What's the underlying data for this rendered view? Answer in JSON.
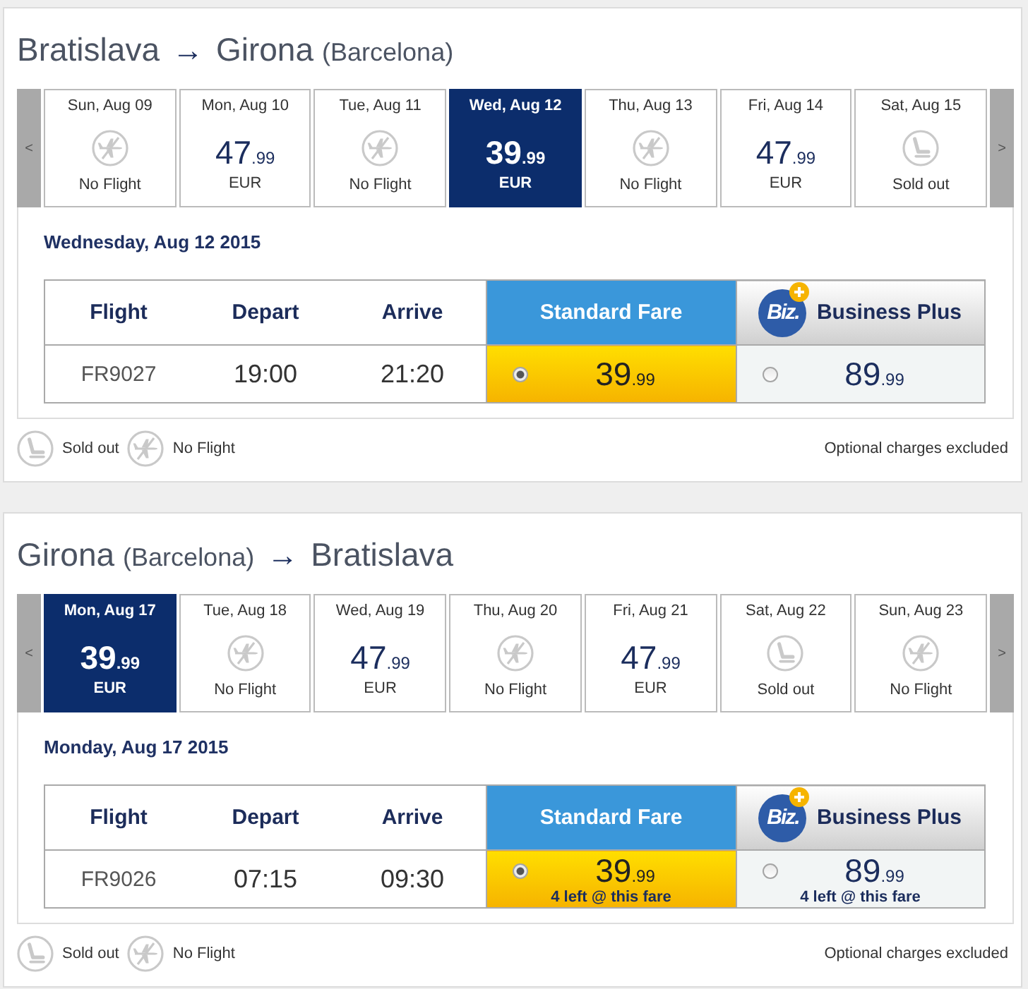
{
  "journeys": [
    {
      "origin": {
        "city": "Bratislava"
      },
      "arrow": "→",
      "destination": {
        "city": "Girona",
        "area": "(Barcelona)"
      },
      "prev_label": "<",
      "next_label": ">",
      "days": [
        {
          "date": "Sun, Aug 09",
          "kind": "no_flight",
          "label": "No Flight",
          "selected": false
        },
        {
          "date": "Mon, Aug 10",
          "kind": "fare",
          "amount": "47",
          "decimals": ".99",
          "currency": "EUR",
          "selected": false
        },
        {
          "date": "Tue, Aug 11",
          "kind": "no_flight",
          "label": "No Flight",
          "selected": false
        },
        {
          "date": "Wed, Aug 12",
          "kind": "fare",
          "amount": "39",
          "decimals": ".99",
          "currency": "EUR",
          "selected": true
        },
        {
          "date": "Thu, Aug 13",
          "kind": "no_flight",
          "label": "No Flight",
          "selected": false
        },
        {
          "date": "Fri, Aug 14",
          "kind": "fare",
          "amount": "47",
          "decimals": ".99",
          "currency": "EUR",
          "selected": false
        },
        {
          "date": "Sat, Aug 15",
          "kind": "sold_out",
          "label": "Sold out",
          "selected": false
        }
      ],
      "day_heading": "Wednesday, Aug 12 2015",
      "columns": [
        {
          "kind": "info",
          "label": "Flight"
        },
        {
          "kind": "info",
          "label": "Depart"
        },
        {
          "kind": "info",
          "label": "Arrive"
        },
        {
          "kind": "standard_fare",
          "label": "Standard Fare"
        },
        {
          "kind": "business_fare",
          "label": "Business Plus",
          "logo": "Biz."
        }
      ],
      "flights": [
        {
          "flight": "FR9027",
          "depart": "19:00",
          "arrive": "21:20",
          "fares": [
            {
              "amount": "39",
              "decimals": ".99",
              "selected": true
            },
            {
              "amount": "89",
              "decimals": ".99",
              "selected": false
            }
          ]
        }
      ],
      "legend": [
        {
          "kind": "sold_out",
          "label": "Sold out"
        },
        {
          "kind": "no_flight",
          "label": "No Flight"
        }
      ],
      "footnote": "Optional charges excluded"
    },
    {
      "origin": {
        "city": "Girona",
        "area": "(Barcelona)"
      },
      "arrow": "→",
      "destination": {
        "city": "Bratislava"
      },
      "prev_label": "<",
      "next_label": ">",
      "days": [
        {
          "date": "Mon, Aug 17",
          "kind": "fare",
          "amount": "39",
          "decimals": ".99",
          "currency": "EUR",
          "selected": true
        },
        {
          "date": "Tue, Aug 18",
          "kind": "no_flight",
          "label": "No Flight",
          "selected": false
        },
        {
          "date": "Wed, Aug 19",
          "kind": "fare",
          "amount": "47",
          "decimals": ".99",
          "currency": "EUR",
          "selected": false
        },
        {
          "date": "Thu, Aug 20",
          "kind": "no_flight",
          "label": "No Flight",
          "selected": false
        },
        {
          "date": "Fri, Aug 21",
          "kind": "fare",
          "amount": "47",
          "decimals": ".99",
          "currency": "EUR",
          "selected": false
        },
        {
          "date": "Sat, Aug 22",
          "kind": "sold_out",
          "label": "Sold out",
          "selected": false
        },
        {
          "date": "Sun, Aug 23",
          "kind": "no_flight",
          "label": "No Flight",
          "selected": false
        }
      ],
      "day_heading": "Monday, Aug 17 2015",
      "columns": [
        {
          "kind": "info",
          "label": "Flight"
        },
        {
          "kind": "info",
          "label": "Depart"
        },
        {
          "kind": "info",
          "label": "Arrive"
        },
        {
          "kind": "standard_fare",
          "label": "Standard Fare"
        },
        {
          "kind": "business_fare",
          "label": "Business Plus",
          "logo": "Biz."
        }
      ],
      "flights": [
        {
          "flight": "FR9026",
          "depart": "07:15",
          "arrive": "09:30",
          "fares": [
            {
              "amount": "39",
              "decimals": ".99",
              "selected": true,
              "note": "4 left @ this fare"
            },
            {
              "amount": "89",
              "decimals": ".99",
              "selected": false,
              "note": "4 left @ this fare"
            }
          ]
        }
      ],
      "legend": [
        {
          "kind": "sold_out",
          "label": "Sold out"
        },
        {
          "kind": "no_flight",
          "label": "No Flight"
        }
      ],
      "footnote": "Optional charges excluded"
    }
  ]
}
